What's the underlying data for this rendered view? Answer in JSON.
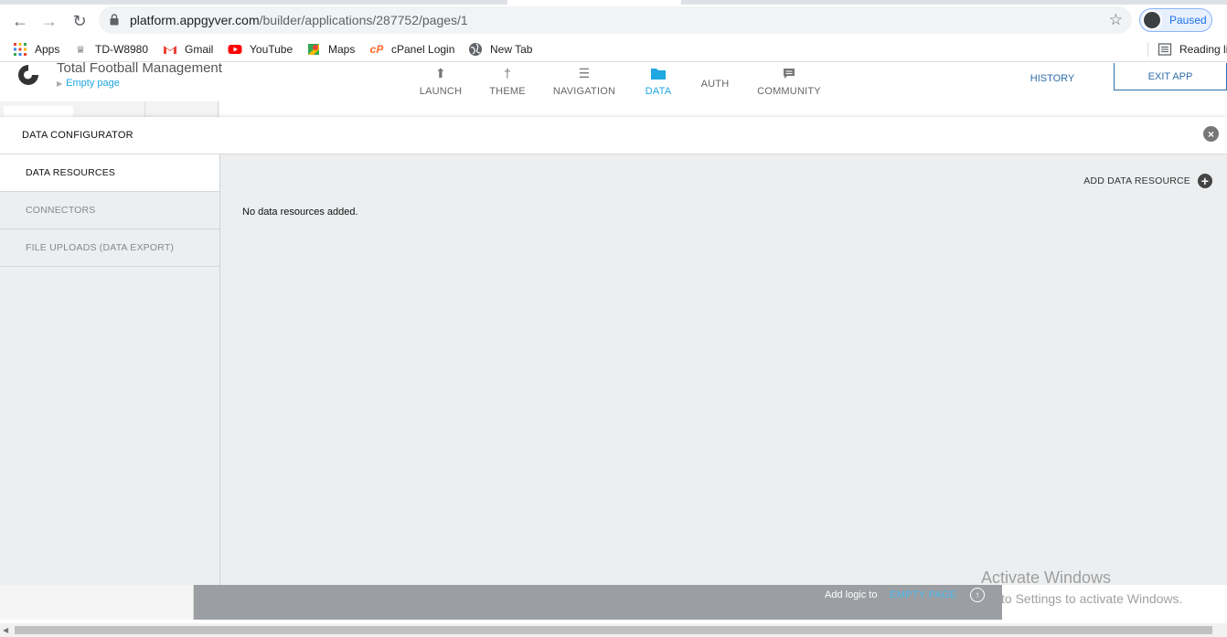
{
  "browser": {
    "url_host": "platform.appgyver.com",
    "url_path": "/builder/applications/287752/pages/1",
    "profile_status": "Paused",
    "bookmarks": [
      {
        "label": "Apps",
        "icon": "apps-grid-icon"
      },
      {
        "label": "TD-W8980",
        "icon": "router-icon"
      },
      {
        "label": "Gmail",
        "icon": "gmail-icon"
      },
      {
        "label": "YouTube",
        "icon": "youtube-icon"
      },
      {
        "label": "Maps",
        "icon": "maps-icon"
      },
      {
        "label": "cPanel Login",
        "icon": "cpanel-icon"
      },
      {
        "label": "New Tab",
        "icon": "globe-icon"
      }
    ],
    "reading_list": "Reading li"
  },
  "app": {
    "name": "Total Football Management",
    "page": "Empty page",
    "tabs": [
      {
        "label": "LAUNCH",
        "icon": "launch-icon"
      },
      {
        "label": "THEME",
        "icon": "theme-brush-icon"
      },
      {
        "label": "NAVIGATION",
        "icon": "list-icon"
      },
      {
        "label": "DATA",
        "icon": "folder-icon"
      },
      {
        "label": "AUTH",
        "icon": ""
      },
      {
        "label": "COMMUNITY",
        "icon": "chat-icon"
      }
    ],
    "active_tab": "DATA",
    "history": "HISTORY",
    "exit": "EXIT APP",
    "accent": "#1ea7e1"
  },
  "modal": {
    "title": "DATA CONFIGURATOR",
    "sidebar": [
      {
        "label": "DATA RESOURCES",
        "active": true
      },
      {
        "label": "CONNECTORS",
        "active": false
      },
      {
        "label": "FILE UPLOADS (DATA EXPORT)",
        "active": false
      }
    ],
    "add_resource": "ADD DATA RESOURCE",
    "empty_message": "No data resources added."
  },
  "bottom": {
    "logic_label": "Add logic to",
    "logic_page": "EMPTY PAGE"
  },
  "os": {
    "activate_title": "Activate Windows",
    "activate_sub": "to Settings to activate Windows."
  }
}
